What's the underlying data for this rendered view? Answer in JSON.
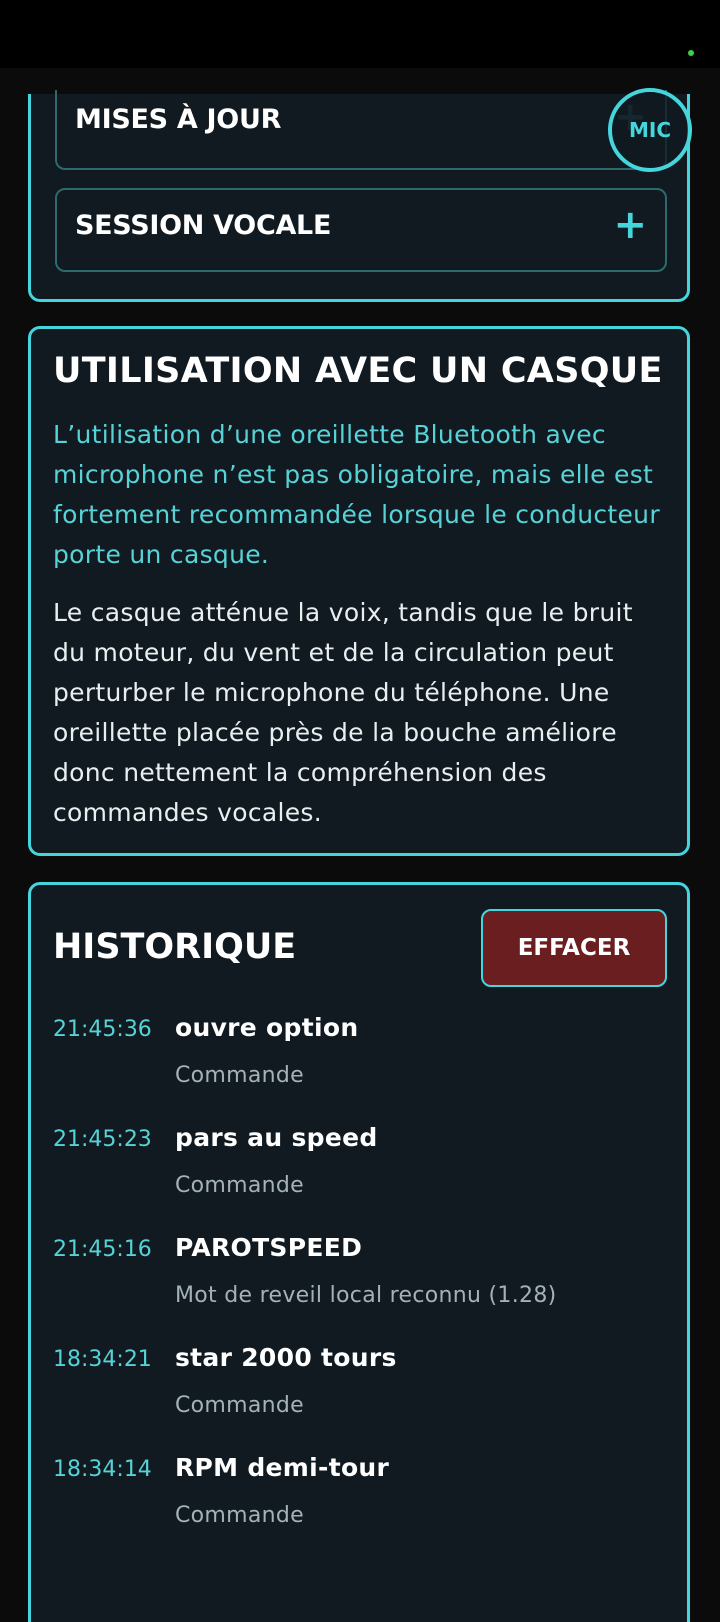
{
  "sections": {
    "updates_label": "MISES À JOUR",
    "voice_session_label": "SESSION VOCALE",
    "expand_symbol": "+"
  },
  "mic": {
    "label": "MIC"
  },
  "helmet": {
    "title": "UTILISATION AVEC UN CASQUE",
    "paragraph_1": "L’utilisation d’une oreillette Bluetooth avec microphone n’est pas obligatoire, mais elle est fortement recommandée lorsque le conducteur porte un casque.",
    "paragraph_2": "Le casque atténue la voix, tandis que le bruit du moteur, du vent et de la circulation peut perturber le microphone du téléphone. Une oreillette placée près de la bouche améliore donc nettement la compréhension des commandes vocales."
  },
  "history": {
    "title": "HISTORIQUE",
    "clear_label": "EFFACER",
    "items": [
      {
        "time": "21:45:36",
        "text": "ouvre option",
        "kind": "Commande"
      },
      {
        "time": "21:45:23",
        "text": "pars au speed",
        "kind": "Commande"
      },
      {
        "time": "21:45:16",
        "text": "PAROTSPEED",
        "kind": "Mot de reveil local reconnu (1.28)"
      },
      {
        "time": "18:34:21",
        "text": "star 2000 tours",
        "kind": "Commande"
      },
      {
        "time": "18:34:14",
        "text": "RPM demi-tour",
        "kind": "Commande"
      }
    ]
  },
  "colors": {
    "accent": "#45d6dd",
    "card_bg": "#111a20",
    "danger": "#6b1e1f"
  }
}
